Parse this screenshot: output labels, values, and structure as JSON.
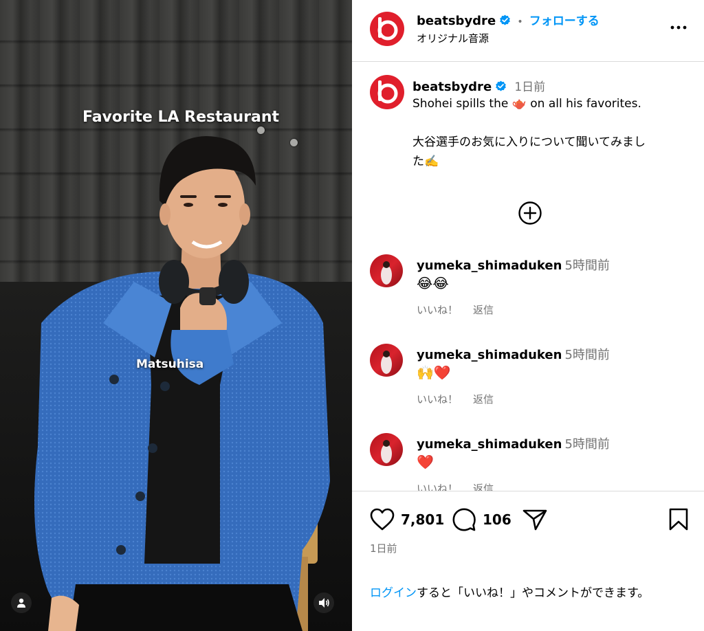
{
  "video": {
    "overlay_title": "Favorite LA Restaurant",
    "overlay_sub": "Matsuhisa",
    "profile_icon": "user-icon",
    "sound_icon": "volume-icon"
  },
  "header": {
    "username": "beatsbydre",
    "separator": "•",
    "follow_label": "フォローする",
    "audio_label": "オリジナル音源",
    "more_icon": "more-horizontal-icon",
    "brand_color": "#e01f2c",
    "verified_color": "#0095f6"
  },
  "post": {
    "username": "beatsbydre",
    "time": "1日前",
    "caption_line1": "Shohei spills the 🫖 on all his favorites.",
    "caption_line2": "大谷選手のお気に入りについて聞いてみまし",
    "caption_line3": "た✍️",
    "load_more_icon": "plus-circle-icon"
  },
  "comments": [
    {
      "username": "yumeka_shimaduken",
      "time": "5時間前",
      "text": "😂😂",
      "like": "いいね！",
      "reply": "返信"
    },
    {
      "username": "yumeka_shimaduken",
      "time": "5時間前",
      "text": "🙌❤️",
      "like": "いいね！",
      "reply": "返信"
    },
    {
      "username": "yumeka_shimaduken",
      "time": "5時間前",
      "text": "❤️",
      "like": "いいね！",
      "reply": "返信"
    }
  ],
  "actions": {
    "like_count": "7,801",
    "comment_count": "106",
    "date": "1日前",
    "like_icon": "heart-icon",
    "comment_icon": "comment-icon",
    "share_icon": "send-icon",
    "save_icon": "bookmark-icon",
    "login_link": "ログイン",
    "login_rest": "すると「いいね！」やコメントができます。"
  }
}
